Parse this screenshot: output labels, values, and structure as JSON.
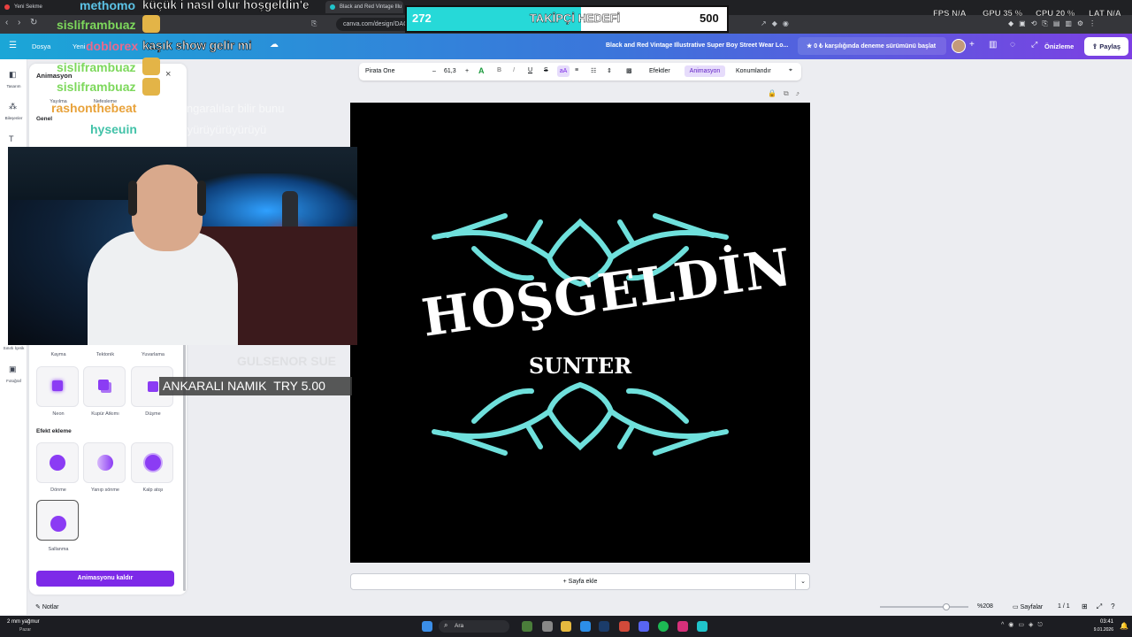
{
  "browser": {
    "tabs": [
      "Yeni Sekme",
      "",
      "",
      "Black and Red Vintage Illu"
    ],
    "url": "canva.com/design/DAG"
  },
  "header": {
    "menu_file": "Dosya",
    "menu_resize": "Yeni",
    "design_title": "Black and Red Vintage Illustrative Super Boy Street Wear Lo...",
    "trial_text": "0 ₺ karşılığında deneme sürümünü başlat",
    "preview_label": "Önizleme",
    "share_label": "Paylaş"
  },
  "rail": {
    "items": [
      "Tasarım",
      "Bileşenler",
      "",
      "",
      "",
      "",
      "",
      "",
      "",
      "Sınırlı İçerik",
      "Fotoğraf"
    ]
  },
  "panel": {
    "title": "Animasyon",
    "tabs_visible": [
      "Yayılma",
      "Nefesleme"
    ],
    "section_general": "Genel",
    "row_labels_top": [
      "Kayma",
      "Tektonik",
      "Yuvarlama"
    ],
    "row_labels_mid": [
      "Neon",
      "Kupür Atkımı",
      "Düşme"
    ],
    "section_effects": "Efekt ekleme",
    "effects": [
      "Dönme",
      "Yanıp sönme",
      "Kalp atışı"
    ],
    "effects_more": [
      "Sallanma"
    ],
    "remove_button": "Animasyonu kaldır"
  },
  "toolbar": {
    "font": "Pirata One",
    "size": "61,3",
    "effects": "Efektler",
    "animation": "Animasyon",
    "position": "Konumlandır"
  },
  "canvas": {
    "title": "HOŞGELDİN",
    "subtitle": "SUNTER"
  },
  "add_page": "+ Sayfa ekle",
  "bottom": {
    "notes": "Notlar",
    "zoom": "%208",
    "pages_label": "Sayfalar",
    "page_count": "1 / 1"
  },
  "taskbar": {
    "weather": "2 mm yağmur",
    "weather_sub": "Pazar",
    "search": "Ara",
    "time": "03:41",
    "date": "9.01.2026"
  },
  "stream": {
    "chat": [
      {
        "user": "methomo",
        "msg": "küçük i nasıl olur hoşgeldin'e"
      },
      {
        "user": "sisliframbuaz",
        "msg": ""
      },
      {
        "user": "doblorex",
        "msg": "kaşık show gelir mi"
      },
      {
        "user": "sisliframbuaz",
        "msg": ""
      },
      {
        "user": "sisliframbuaz",
        "msg": ""
      },
      {
        "user": "rashonthebeat",
        "msg": "gerçek angaralılar bilir bunu"
      },
      {
        "user": "hyseuin",
        "msg": "yürüyürüyürüyürüyürüyü"
      }
    ],
    "goal": {
      "current": "272",
      "label": "TAKİPÇİ HEDEFİ",
      "target": "500",
      "progress": 0.544
    },
    "donation": {
      "name": "ANKARALI NAMIK",
      "amount": "TRY 5.00"
    },
    "ghost_text": "GULSENOR SUE",
    "stats": {
      "fps_label": "FPS",
      "fps": "N/A",
      "gpu_label": "GPU",
      "gpu": "35 %",
      "cpu_label": "CPU",
      "cpu": "20 %",
      "lat_label": "LAT",
      "lat": "N/A"
    }
  },
  "colors": {
    "purple": "#7d2ae8",
    "goal_fill": "#26d9d8",
    "teal_art": "#6fe0dc"
  }
}
